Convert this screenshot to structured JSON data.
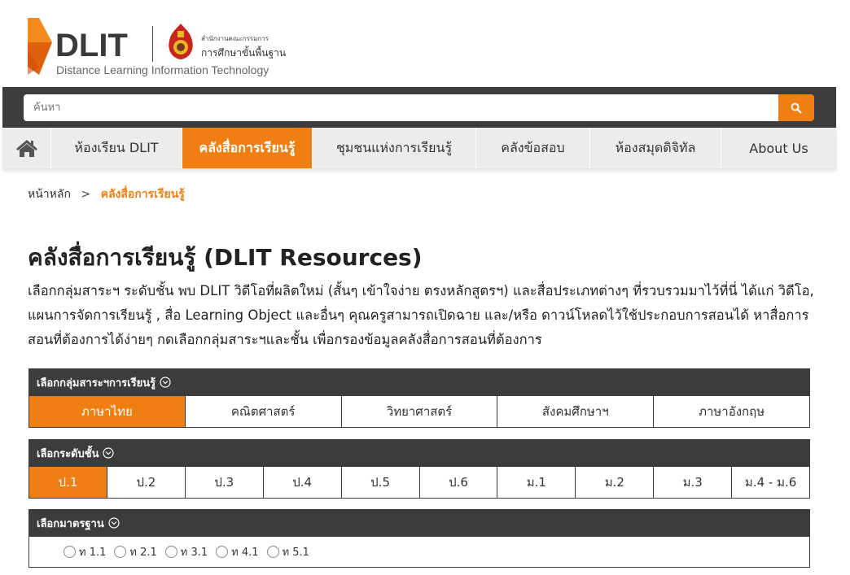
{
  "logo": {
    "brand": "DLIT",
    "subtitle": "Distance Learning Information Technology",
    "partner_small": "สำนักงานคณะกรรมการ",
    "partner_big": "การศึกษาขั้นพื้นฐาน",
    "colors": {
      "orange": "#f07f13",
      "dark_orange": "#e0600e"
    }
  },
  "search": {
    "placeholder": "ค้นหา",
    "value": "",
    "button_icon": "search-icon"
  },
  "nav": {
    "home_icon": "home-icon",
    "items": [
      {
        "label": "ห้องเรียน DLIT",
        "active": false
      },
      {
        "label": "คลังสื่อการเรียนรู้",
        "active": true
      },
      {
        "label": "ชุมชนแห่งการเรียนรู้",
        "active": false
      },
      {
        "label": "คลังข้อสอบ",
        "active": false
      },
      {
        "label": "ห้องสมุดดิจิทัล",
        "active": false
      },
      {
        "label": "About Us",
        "active": false
      }
    ]
  },
  "breadcrumb": {
    "home": "หน้าหลัก",
    "separator": ">",
    "current": "คลังสื่อการเรียนรู้"
  },
  "page": {
    "title": "คลังสื่อการเรียนรู้ (DLIT Resources)",
    "description": "เลือกกลุ่มสาระฯ ระดับชั้น พบ DLIT วิดีโอที่ผลิตใหม่ (สั้นๆ เข้าใจง่าย ตรงหลักสูตรฯ) และสื่อประเภทต่างๆ ที่รวบรวมมาไว้ที่นี่ ได้แก่ วิดีโอ, แผนการจัดการเรียนรู้ , สื่อ Learning Object และอื่นๆ คุณครูสามารถเปิดฉาย และ/หรือ ดาวน์โหลดไว้ใช้ประกอบการสอนได้ หาสื่อการสอนที่ต้องการได้ง่ายๆ กดเลือกกลุ่มสาระฯและชั้น เพื่อกรองข้อมูลคลังสื่อการสอนที่ต้องการ"
  },
  "filters": {
    "subject": {
      "heading": "เลือกกลุ่มสาระฯการเรียนรู้",
      "options": [
        "ภาษาไทย",
        "คณิตศาสตร์",
        "วิทยาศาสตร์",
        "สังคมศึกษาฯ",
        "ภาษาอังกฤษ"
      ],
      "selected": "ภาษาไทย"
    },
    "level": {
      "heading": "เลือกระดับชั้น",
      "options": [
        "ป.1",
        "ป.2",
        "ป.3",
        "ป.4",
        "ป.5",
        "ป.6",
        "ม.1",
        "ม.2",
        "ม.3",
        "ม.4 - ม.6"
      ],
      "selected": "ป.1"
    },
    "standard": {
      "heading": "เลือกมาตรฐาน",
      "options": [
        "ท 1.1",
        "ท 2.1",
        "ท 3.1",
        "ท 4.1",
        "ท 5.1"
      ],
      "selected": null
    }
  }
}
